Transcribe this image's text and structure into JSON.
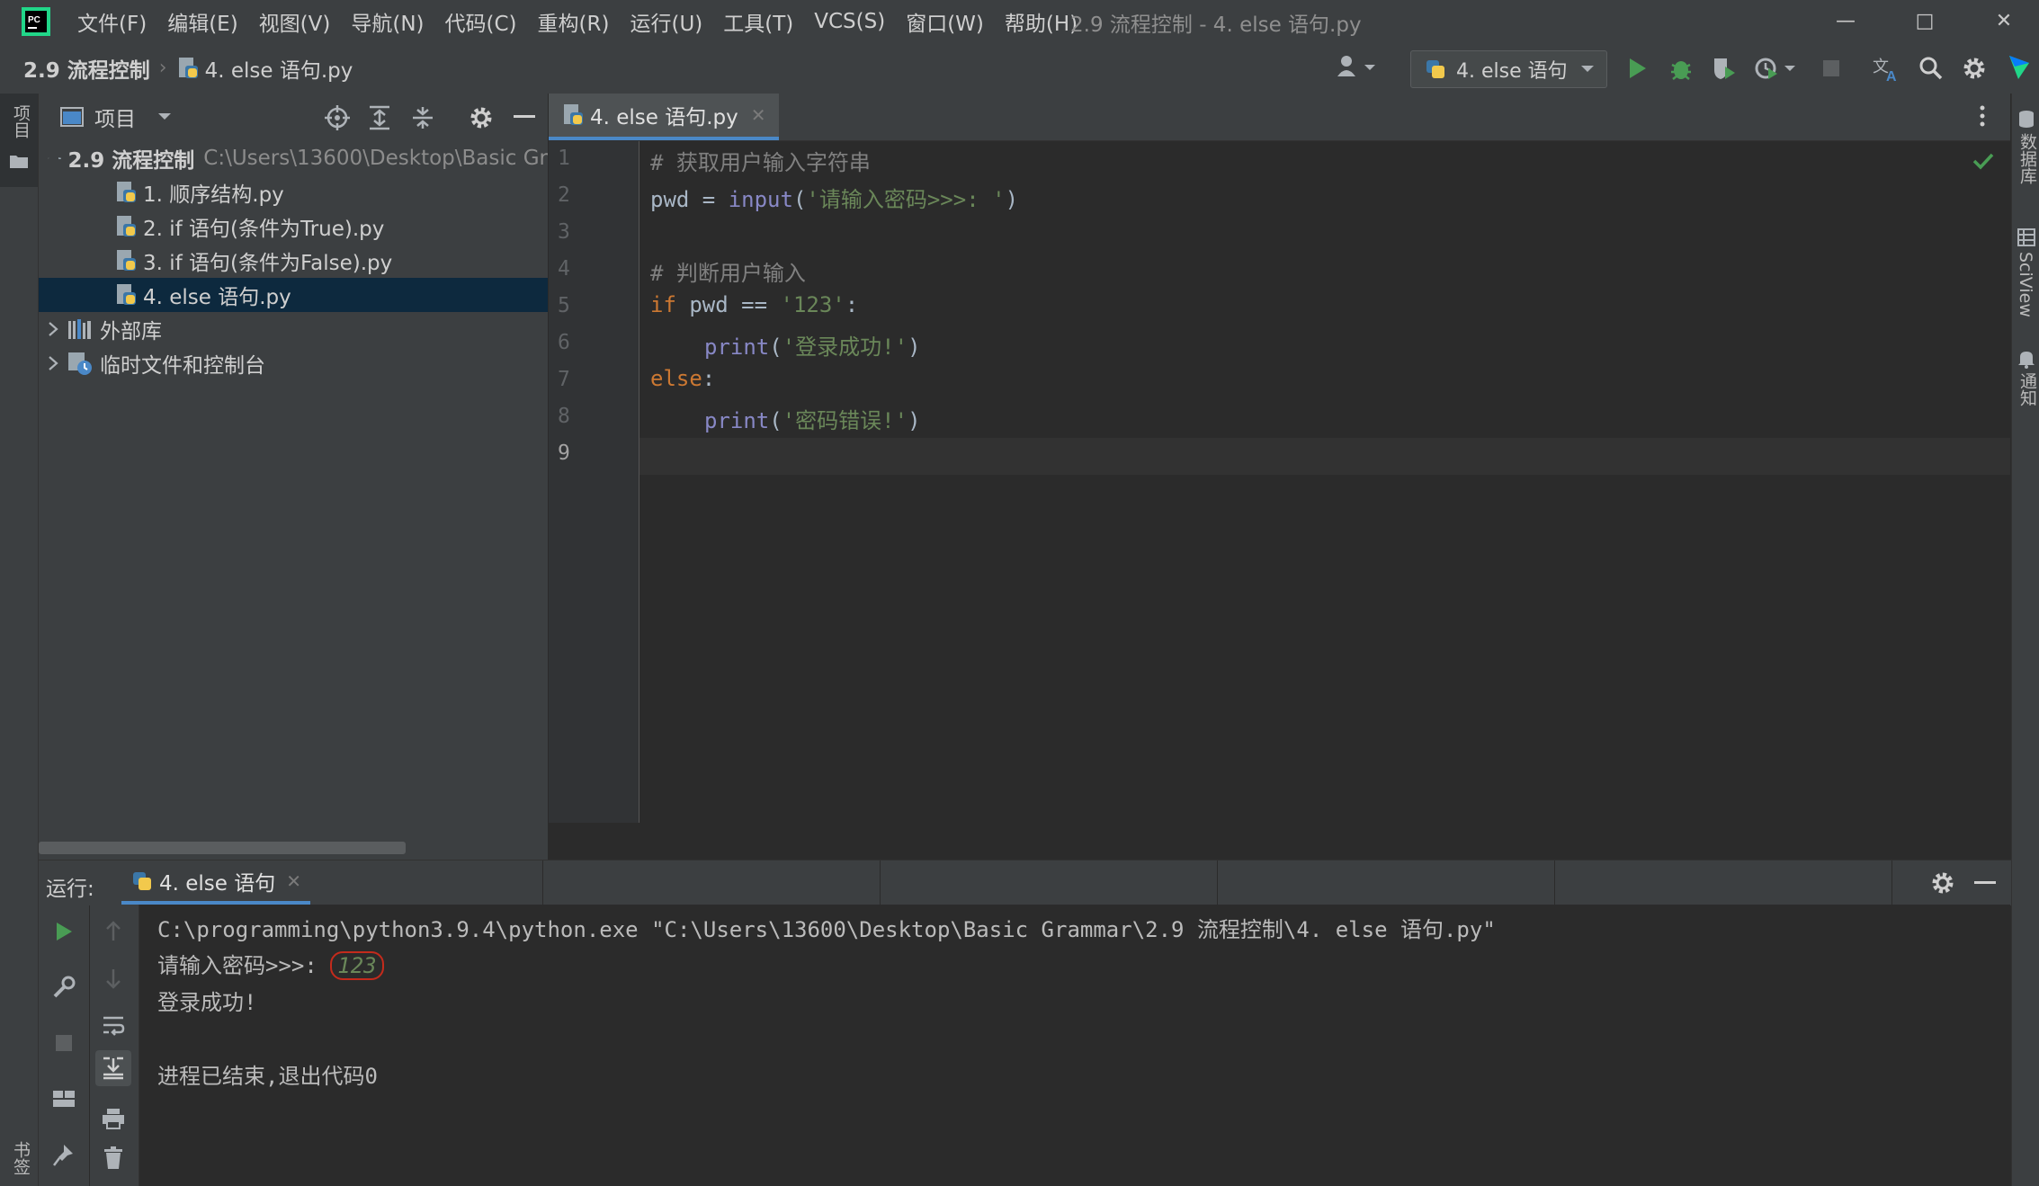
{
  "menubar": {
    "items": [
      "文件(F)",
      "编辑(E)",
      "视图(V)",
      "导航(N)",
      "代码(C)",
      "重构(R)",
      "运行(U)",
      "工具(T)",
      "VCS(S)",
      "窗口(W)",
      "帮助(H)"
    ],
    "window_title": "2.9 流程控制 - 4. else 语句.py"
  },
  "navbar": {
    "project_crumb": "2.9 流程控制",
    "file_crumb": "4. else 语句.py",
    "run_config": "4. else 语句"
  },
  "project_panel": {
    "title": "项目",
    "root_name": "2.9 流程控制",
    "root_path": "C:\\Users\\13600\\Desktop\\Basic Gr",
    "files": [
      "1. 顺序结构.py",
      "2. if 语句(条件为True).py",
      "3. if 语句(条件为False).py",
      "4. else 语句.py"
    ],
    "external_libs": "外部库",
    "scratches": "临时文件和控制台"
  },
  "editor": {
    "tab_label": "4. else 语句.py",
    "line_numbers": [
      "1",
      "2",
      "3",
      "4",
      "5",
      "6",
      "7",
      "8",
      "9"
    ],
    "code": {
      "l1_comment": "# 获取用户输入字符串",
      "l2_var": "pwd = ",
      "l2_fn": "input",
      "l2_open": "(",
      "l2_str": "'请输入密码>>>: '",
      "l2_close": ")",
      "l4_comment": "# 判断用户输入",
      "l5_kw": "if",
      "l5_mid": " pwd == ",
      "l5_str": "'123'",
      "l5_end": ":",
      "l6_fn": "print",
      "l6_open": "(",
      "l6_str": "'登录成功!'",
      "l6_close": ")",
      "l7_kw": "else",
      "l7_end": ":",
      "l8_fn": "print",
      "l8_open": "(",
      "l8_str": "'密码错误!'",
      "l8_close": ")"
    }
  },
  "right_strip": {
    "database": "数据库",
    "sciview": "SciView",
    "notifications": "通知"
  },
  "left_strip": {
    "project": "项目",
    "bookmarks": "书签"
  },
  "run_panel": {
    "label": "运行:",
    "tab_label": "4. else 语句",
    "console": {
      "command": "C:\\programming\\python3.9.4\\python.exe \"C:\\Users\\13600\\Desktop\\Basic Grammar\\2.9 流程控制\\4. else 语句.py\"",
      "prompt": "请输入密码>>>: ",
      "user_input": "123",
      "output": "登录成功!",
      "exit_message": "进程已结束,退出代码0"
    }
  },
  "colors": {
    "accent": "#4a88c7",
    "run_green": "#499c54",
    "keyword": "#cc7832",
    "string": "#6a8759"
  }
}
